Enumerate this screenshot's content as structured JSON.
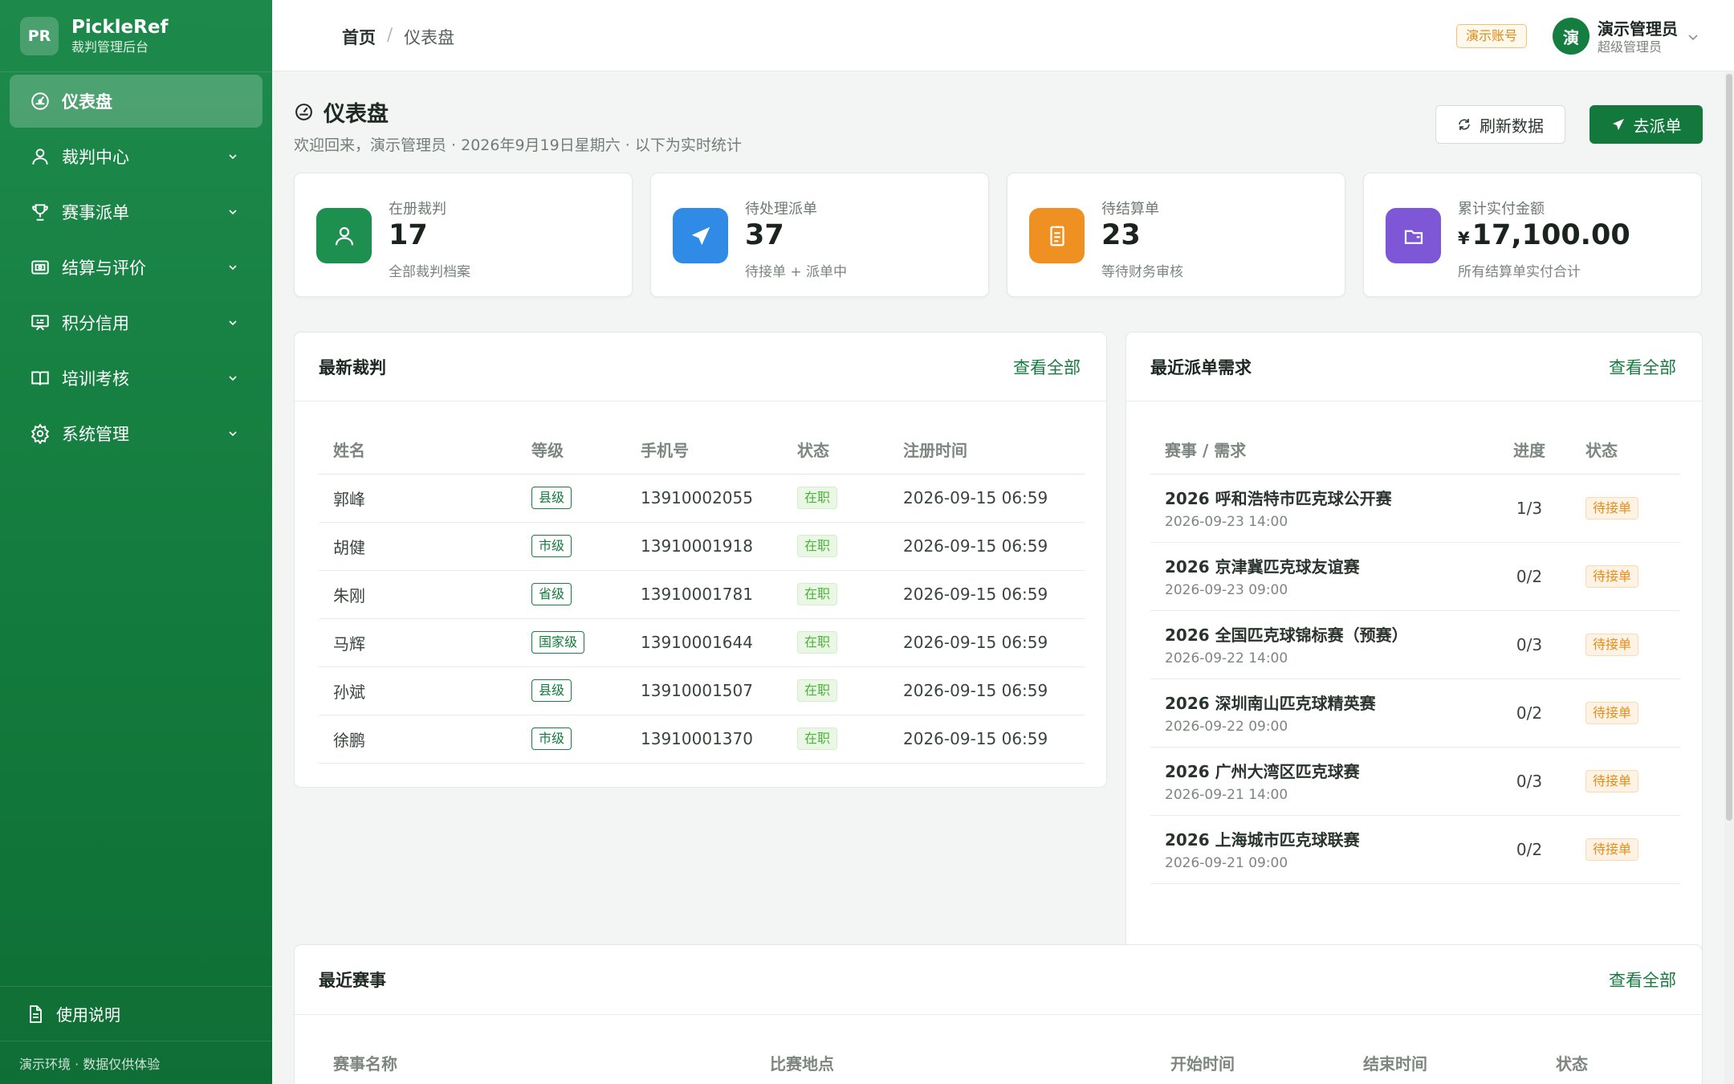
{
  "brand": {
    "logo": "PR",
    "name": "PickleRef",
    "subtitle": "裁判管理后台"
  },
  "sidebar": {
    "items": [
      {
        "label": "仪表盘",
        "icon": "gauge-icon"
      },
      {
        "label": "裁判中心",
        "icon": "user-icon"
      },
      {
        "label": "赛事派单",
        "icon": "trophy-icon"
      },
      {
        "label": "结算与评价",
        "icon": "wallet-icon"
      },
      {
        "label": "积分信用",
        "icon": "board-icon"
      },
      {
        "label": "培训考核",
        "icon": "book-icon"
      },
      {
        "label": "系统管理",
        "icon": "gear-icon"
      }
    ],
    "help": "使用说明",
    "env": "演示环境 · 数据仅供体验"
  },
  "header": {
    "breadcrumb_home": "首页",
    "breadcrumb_sep": "/",
    "breadcrumb_current": "仪表盘",
    "demo_badge": "演示账号",
    "avatar": "演",
    "user_name": "演示管理员",
    "user_role": "超级管理员"
  },
  "page": {
    "title": "仪表盘",
    "subtitle": "欢迎回来，演示管理员 · 2026年9月19日星期六 · 以下为实时统计",
    "refresh_label": "刷新数据",
    "dispatch_label": "去派单"
  },
  "stats": [
    {
      "label": "在册裁判",
      "value": "17",
      "note": "全部裁判档案",
      "color": "#1d8f4e"
    },
    {
      "label": "待处理派单",
      "value": "37",
      "note": "待接单 + 派单中",
      "color": "#2f8be6"
    },
    {
      "label": "待结算单",
      "value": "23",
      "note": "等待财务审核",
      "color": "#ef9122"
    },
    {
      "label": "累计实付金额",
      "currency": "¥",
      "value": "17,100.00",
      "note": "所有结算单实付合计",
      "color": "#7e57d6"
    }
  ],
  "referees": {
    "title": "最新裁判",
    "view_all": "查看全部",
    "columns": [
      "姓名",
      "等级",
      "手机号",
      "状态",
      "注册时间"
    ],
    "rows": [
      {
        "name": "郭峰",
        "level": "县级",
        "phone": "13910002055",
        "status": "在职",
        "time": "2026-09-15 06:59"
      },
      {
        "name": "胡健",
        "level": "市级",
        "phone": "13910001918",
        "status": "在职",
        "time": "2026-09-15 06:59"
      },
      {
        "name": "朱刚",
        "level": "省级",
        "phone": "13910001781",
        "status": "在职",
        "time": "2026-09-15 06:59"
      },
      {
        "name": "马辉",
        "level": "国家级",
        "phone": "13910001644",
        "status": "在职",
        "time": "2026-09-15 06:59"
      },
      {
        "name": "孙斌",
        "level": "县级",
        "phone": "13910001507",
        "status": "在职",
        "time": "2026-09-15 06:59"
      },
      {
        "name": "徐鹏",
        "level": "市级",
        "phone": "13910001370",
        "status": "在职",
        "time": "2026-09-15 06:59"
      }
    ]
  },
  "dispatch": {
    "title": "最近派单需求",
    "view_all": "查看全部",
    "columns": [
      "赛事 / 需求",
      "进度",
      "状态"
    ],
    "rows": [
      {
        "name": "2026 呼和浩特市匹克球公开赛",
        "time": "2026-09-23 14:00",
        "progress": "1/3",
        "status": "待接单"
      },
      {
        "name": "2026 京津冀匹克球友谊赛",
        "time": "2026-09-23 09:00",
        "progress": "0/2",
        "status": "待接单"
      },
      {
        "name": "2026 全国匹克球锦标赛（预赛）",
        "time": "2026-09-22 14:00",
        "progress": "0/3",
        "status": "待接单"
      },
      {
        "name": "2026 深圳南山匹克球精英赛",
        "time": "2026-09-22 09:00",
        "progress": "0/2",
        "status": "待接单"
      },
      {
        "name": "2026 广州大湾区匹克球赛",
        "time": "2026-09-21 14:00",
        "progress": "0/3",
        "status": "待接单"
      },
      {
        "name": "2026 上海城市匹克球联赛",
        "time": "2026-09-21 09:00",
        "progress": "0/2",
        "status": "待接单"
      }
    ]
  },
  "events": {
    "title": "最近赛事",
    "view_all": "查看全部",
    "columns": [
      "赛事名称",
      "比赛地点",
      "开始时间",
      "结束时间",
      "状态"
    ]
  }
}
